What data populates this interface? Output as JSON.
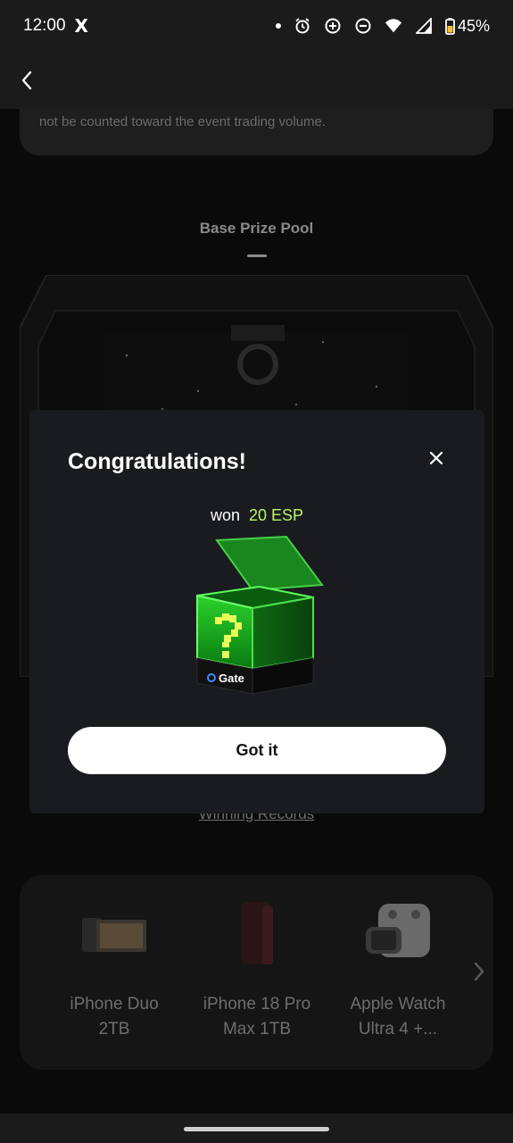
{
  "status_bar": {
    "time": "12:00",
    "app_icon": "X",
    "battery": "45%"
  },
  "rules": {
    "text": "not be counted toward the event trading volume."
  },
  "prize_pool": {
    "title": "Base Prize Pool"
  },
  "modal": {
    "title": "Congratulations!",
    "won_label": "won",
    "won_amount": "20 ESP",
    "box_brand": "Gate",
    "box_glyph": "?",
    "button_label": "Got it"
  },
  "winning_records": "Winning Records",
  "prizes": [
    {
      "line1": "iPhone Duo",
      "line2": "2TB"
    },
    {
      "line1": "iPhone 18 Pro",
      "line2": "Max 1TB"
    },
    {
      "line1": "Apple Watch",
      "line2": "Ultra 4 +..."
    }
  ],
  "colors": {
    "accent_green": "#b8f56b",
    "modal_bg": "#1a1b1e",
    "button_bg": "#ffffff"
  }
}
